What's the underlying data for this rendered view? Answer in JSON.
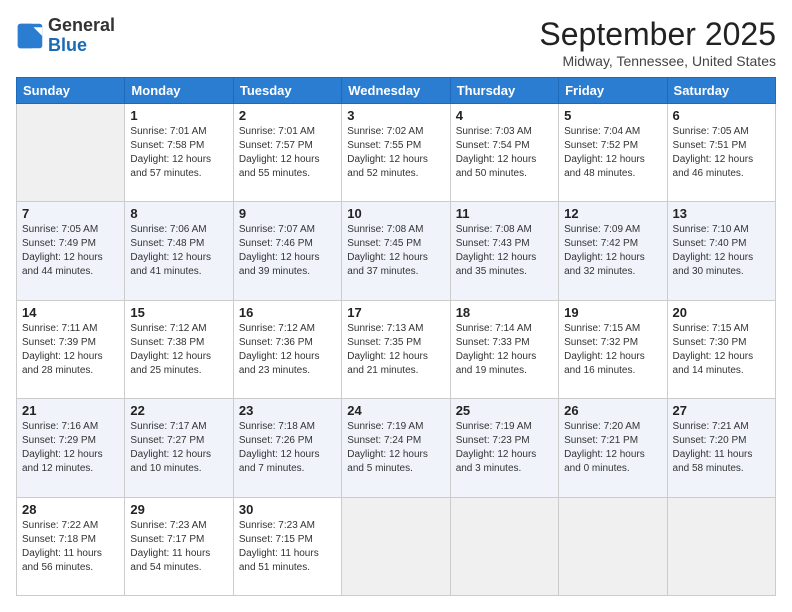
{
  "logo": {
    "general": "General",
    "blue": "Blue"
  },
  "header": {
    "month": "September 2025",
    "location": "Midway, Tennessee, United States"
  },
  "days_of_week": [
    "Sunday",
    "Monday",
    "Tuesday",
    "Wednesday",
    "Thursday",
    "Friday",
    "Saturday"
  ],
  "weeks": [
    [
      {
        "day": "",
        "sunrise": "",
        "sunset": "",
        "daylight": ""
      },
      {
        "day": "1",
        "sunrise": "Sunrise: 7:01 AM",
        "sunset": "Sunset: 7:58 PM",
        "daylight": "Daylight: 12 hours and 57 minutes."
      },
      {
        "day": "2",
        "sunrise": "Sunrise: 7:01 AM",
        "sunset": "Sunset: 7:57 PM",
        "daylight": "Daylight: 12 hours and 55 minutes."
      },
      {
        "day": "3",
        "sunrise": "Sunrise: 7:02 AM",
        "sunset": "Sunset: 7:55 PM",
        "daylight": "Daylight: 12 hours and 52 minutes."
      },
      {
        "day": "4",
        "sunrise": "Sunrise: 7:03 AM",
        "sunset": "Sunset: 7:54 PM",
        "daylight": "Daylight: 12 hours and 50 minutes."
      },
      {
        "day": "5",
        "sunrise": "Sunrise: 7:04 AM",
        "sunset": "Sunset: 7:52 PM",
        "daylight": "Daylight: 12 hours and 48 minutes."
      },
      {
        "day": "6",
        "sunrise": "Sunrise: 7:05 AM",
        "sunset": "Sunset: 7:51 PM",
        "daylight": "Daylight: 12 hours and 46 minutes."
      }
    ],
    [
      {
        "day": "7",
        "sunrise": "Sunrise: 7:05 AM",
        "sunset": "Sunset: 7:49 PM",
        "daylight": "Daylight: 12 hours and 44 minutes."
      },
      {
        "day": "8",
        "sunrise": "Sunrise: 7:06 AM",
        "sunset": "Sunset: 7:48 PM",
        "daylight": "Daylight: 12 hours and 41 minutes."
      },
      {
        "day": "9",
        "sunrise": "Sunrise: 7:07 AM",
        "sunset": "Sunset: 7:46 PM",
        "daylight": "Daylight: 12 hours and 39 minutes."
      },
      {
        "day": "10",
        "sunrise": "Sunrise: 7:08 AM",
        "sunset": "Sunset: 7:45 PM",
        "daylight": "Daylight: 12 hours and 37 minutes."
      },
      {
        "day": "11",
        "sunrise": "Sunrise: 7:08 AM",
        "sunset": "Sunset: 7:43 PM",
        "daylight": "Daylight: 12 hours and 35 minutes."
      },
      {
        "day": "12",
        "sunrise": "Sunrise: 7:09 AM",
        "sunset": "Sunset: 7:42 PM",
        "daylight": "Daylight: 12 hours and 32 minutes."
      },
      {
        "day": "13",
        "sunrise": "Sunrise: 7:10 AM",
        "sunset": "Sunset: 7:40 PM",
        "daylight": "Daylight: 12 hours and 30 minutes."
      }
    ],
    [
      {
        "day": "14",
        "sunrise": "Sunrise: 7:11 AM",
        "sunset": "Sunset: 7:39 PM",
        "daylight": "Daylight: 12 hours and 28 minutes."
      },
      {
        "day": "15",
        "sunrise": "Sunrise: 7:12 AM",
        "sunset": "Sunset: 7:38 PM",
        "daylight": "Daylight: 12 hours and 25 minutes."
      },
      {
        "day": "16",
        "sunrise": "Sunrise: 7:12 AM",
        "sunset": "Sunset: 7:36 PM",
        "daylight": "Daylight: 12 hours and 23 minutes."
      },
      {
        "day": "17",
        "sunrise": "Sunrise: 7:13 AM",
        "sunset": "Sunset: 7:35 PM",
        "daylight": "Daylight: 12 hours and 21 minutes."
      },
      {
        "day": "18",
        "sunrise": "Sunrise: 7:14 AM",
        "sunset": "Sunset: 7:33 PM",
        "daylight": "Daylight: 12 hours and 19 minutes."
      },
      {
        "day": "19",
        "sunrise": "Sunrise: 7:15 AM",
        "sunset": "Sunset: 7:32 PM",
        "daylight": "Daylight: 12 hours and 16 minutes."
      },
      {
        "day": "20",
        "sunrise": "Sunrise: 7:15 AM",
        "sunset": "Sunset: 7:30 PM",
        "daylight": "Daylight: 12 hours and 14 minutes."
      }
    ],
    [
      {
        "day": "21",
        "sunrise": "Sunrise: 7:16 AM",
        "sunset": "Sunset: 7:29 PM",
        "daylight": "Daylight: 12 hours and 12 minutes."
      },
      {
        "day": "22",
        "sunrise": "Sunrise: 7:17 AM",
        "sunset": "Sunset: 7:27 PM",
        "daylight": "Daylight: 12 hours and 10 minutes."
      },
      {
        "day": "23",
        "sunrise": "Sunrise: 7:18 AM",
        "sunset": "Sunset: 7:26 PM",
        "daylight": "Daylight: 12 hours and 7 minutes."
      },
      {
        "day": "24",
        "sunrise": "Sunrise: 7:19 AM",
        "sunset": "Sunset: 7:24 PM",
        "daylight": "Daylight: 12 hours and 5 minutes."
      },
      {
        "day": "25",
        "sunrise": "Sunrise: 7:19 AM",
        "sunset": "Sunset: 7:23 PM",
        "daylight": "Daylight: 12 hours and 3 minutes."
      },
      {
        "day": "26",
        "sunrise": "Sunrise: 7:20 AM",
        "sunset": "Sunset: 7:21 PM",
        "daylight": "Daylight: 12 hours and 0 minutes."
      },
      {
        "day": "27",
        "sunrise": "Sunrise: 7:21 AM",
        "sunset": "Sunset: 7:20 PM",
        "daylight": "Daylight: 11 hours and 58 minutes."
      }
    ],
    [
      {
        "day": "28",
        "sunrise": "Sunrise: 7:22 AM",
        "sunset": "Sunset: 7:18 PM",
        "daylight": "Daylight: 11 hours and 56 minutes."
      },
      {
        "day": "29",
        "sunrise": "Sunrise: 7:23 AM",
        "sunset": "Sunset: 7:17 PM",
        "daylight": "Daylight: 11 hours and 54 minutes."
      },
      {
        "day": "30",
        "sunrise": "Sunrise: 7:23 AM",
        "sunset": "Sunset: 7:15 PM",
        "daylight": "Daylight: 11 hours and 51 minutes."
      },
      {
        "day": "",
        "sunrise": "",
        "sunset": "",
        "daylight": ""
      },
      {
        "day": "",
        "sunrise": "",
        "sunset": "",
        "daylight": ""
      },
      {
        "day": "",
        "sunrise": "",
        "sunset": "",
        "daylight": ""
      },
      {
        "day": "",
        "sunrise": "",
        "sunset": "",
        "daylight": ""
      }
    ]
  ]
}
